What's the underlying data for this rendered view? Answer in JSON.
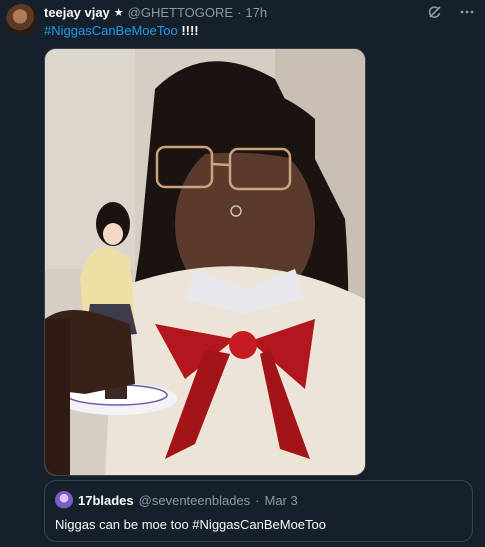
{
  "tweet": {
    "display_name": "teejay vjay",
    "badge_icon": "star-icon",
    "handle": "@GHETTOGORE",
    "separator": "·",
    "time": "17h",
    "hashtag": "#NiggasCanBeMoeToo",
    "suffix": " !!!!",
    "media_icon": "photo"
  },
  "toolbar": {
    "grok_icon": "grok-icon",
    "more_icon": "more-icon"
  },
  "quote": {
    "display_name": "17blades",
    "handle": "@seventeenblades",
    "separator": "·",
    "time": "Mar 3",
    "text": "Niggas can be moe too #NiggasCanBeMoeToo"
  },
  "colors": {
    "background": "#15202b",
    "link": "#1d9bf0",
    "muted": "#8b98a5",
    "border": "#38444d"
  }
}
